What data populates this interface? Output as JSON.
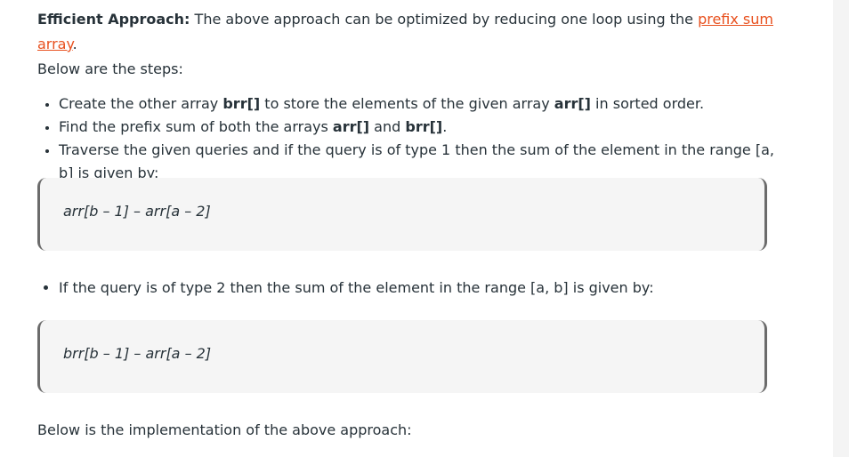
{
  "intro": {
    "heading": "Efficient Approach:",
    "text_before_link": " The above approach can be optimized by reducing one loop using the ",
    "link_text": "prefix sum array",
    "text_after_link": ".",
    "line2": "Below are the steps:"
  },
  "steps": [
    {
      "pre": "Create the other array ",
      "b1": "brr[]",
      "mid": " to store the elements of the given array ",
      "b2": "arr[]",
      "post": " in sorted order."
    },
    {
      "pre": "Find the prefix sum of both the arrays ",
      "b1": "arr[]",
      "mid": " and ",
      "b2": "brr[]",
      "post": "."
    },
    {
      "text": "Traverse the given queries and if the query is of type 1 then the sum of the element in the range [a, b] is given by:"
    }
  ],
  "code_blocks": [
    "arr[b – 1] – arr[a – 2]",
    "brr[b – 1] – arr[a – 2]"
  ],
  "step4": "If the query is of type 2 then the sum of the element in the range [a, b] is given by:",
  "outro": "Below is the implementation of the above approach:",
  "colors": {
    "text": "#273239",
    "link": "#e8501e",
    "code_bg": "#f5f5f5",
    "code_border": "#6b6b6b"
  }
}
